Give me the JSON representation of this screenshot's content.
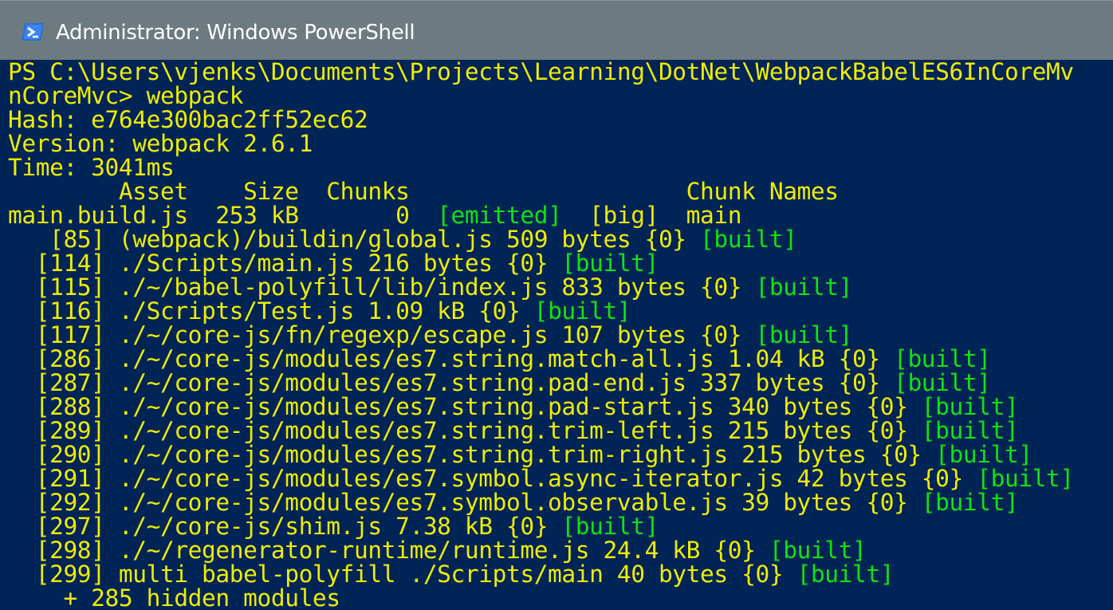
{
  "window": {
    "title": "Administrator: Windows PowerShell",
    "icon": "powershell-icon"
  },
  "colors": {
    "background": "#012456",
    "text": "#eeed00",
    "green": "#13e20e",
    "titlebar": "#6d7b80"
  },
  "console": {
    "lines": [
      [
        {
          "t": "PS C:\\Users\\vjenks\\Documents\\Projects\\Learning\\DotNet\\WebpackBabelES6InCoreMv",
          "c": "y"
        }
      ],
      [
        {
          "t": "nCoreMvc> webpack",
          "c": "y"
        }
      ],
      [
        {
          "t": "Hash: e764e300bac2ff52ec62",
          "c": "y"
        }
      ],
      [
        {
          "t": "Version: webpack 2.6.1",
          "c": "y"
        }
      ],
      [
        {
          "t": "Time: 3041ms",
          "c": "y"
        }
      ],
      [
        {
          "t": "        Asset    Size  Chunks                    Chunk Names",
          "c": "y"
        }
      ],
      [
        {
          "t": "main.build.js  253 kB       0  ",
          "c": "y"
        },
        {
          "t": "[emitted]",
          "c": "g"
        },
        {
          "t": "  [big]  main",
          "c": "y"
        }
      ],
      [
        {
          "t": "   [85] (webpack)/buildin/global.js 509 bytes {0} ",
          "c": "y"
        },
        {
          "t": "[built]",
          "c": "g"
        }
      ],
      [
        {
          "t": "  [114] ./Scripts/main.js 216 bytes {0} ",
          "c": "y"
        },
        {
          "t": "[built]",
          "c": "g"
        }
      ],
      [
        {
          "t": "  [115] ./~/babel-polyfill/lib/index.js 833 bytes {0} ",
          "c": "y"
        },
        {
          "t": "[built]",
          "c": "g"
        }
      ],
      [
        {
          "t": "  [116] ./Scripts/Test.js 1.09 kB {0} ",
          "c": "y"
        },
        {
          "t": "[built]",
          "c": "g"
        }
      ],
      [
        {
          "t": "  [117] ./~/core-js/fn/regexp/escape.js 107 bytes {0} ",
          "c": "y"
        },
        {
          "t": "[built]",
          "c": "g"
        }
      ],
      [
        {
          "t": "  [286] ./~/core-js/modules/es7.string.match-all.js 1.04 kB {0} ",
          "c": "y"
        },
        {
          "t": "[built]",
          "c": "g"
        }
      ],
      [
        {
          "t": "  [287] ./~/core-js/modules/es7.string.pad-end.js 337 bytes {0} ",
          "c": "y"
        },
        {
          "t": "[built]",
          "c": "g"
        }
      ],
      [
        {
          "t": "  [288] ./~/core-js/modules/es7.string.pad-start.js 340 bytes {0} ",
          "c": "y"
        },
        {
          "t": "[built]",
          "c": "g"
        }
      ],
      [
        {
          "t": "  [289] ./~/core-js/modules/es7.string.trim-left.js 215 bytes {0} ",
          "c": "y"
        },
        {
          "t": "[built]",
          "c": "g"
        }
      ],
      [
        {
          "t": "  [290] ./~/core-js/modules/es7.string.trim-right.js 215 bytes {0} ",
          "c": "y"
        },
        {
          "t": "[built]",
          "c": "g"
        }
      ],
      [
        {
          "t": "  [291] ./~/core-js/modules/es7.symbol.async-iterator.js 42 bytes {0} ",
          "c": "y"
        },
        {
          "t": "[built]",
          "c": "g"
        }
      ],
      [
        {
          "t": "  [292] ./~/core-js/modules/es7.symbol.observable.js 39 bytes {0} ",
          "c": "y"
        },
        {
          "t": "[built]",
          "c": "g"
        }
      ],
      [
        {
          "t": "  [297] ./~/core-js/shim.js 7.38 kB {0} ",
          "c": "y"
        },
        {
          "t": "[built]",
          "c": "g"
        }
      ],
      [
        {
          "t": "  [298] ./~/regenerator-runtime/runtime.js 24.4 kB {0} ",
          "c": "y"
        },
        {
          "t": "[built]",
          "c": "g"
        }
      ],
      [
        {
          "t": "  [299] multi babel-polyfill ./Scripts/main 40 bytes {0} ",
          "c": "y"
        },
        {
          "t": "[built]",
          "c": "g"
        }
      ],
      [
        {
          "t": "    + 285 hidden modules",
          "c": "y"
        }
      ]
    ]
  }
}
